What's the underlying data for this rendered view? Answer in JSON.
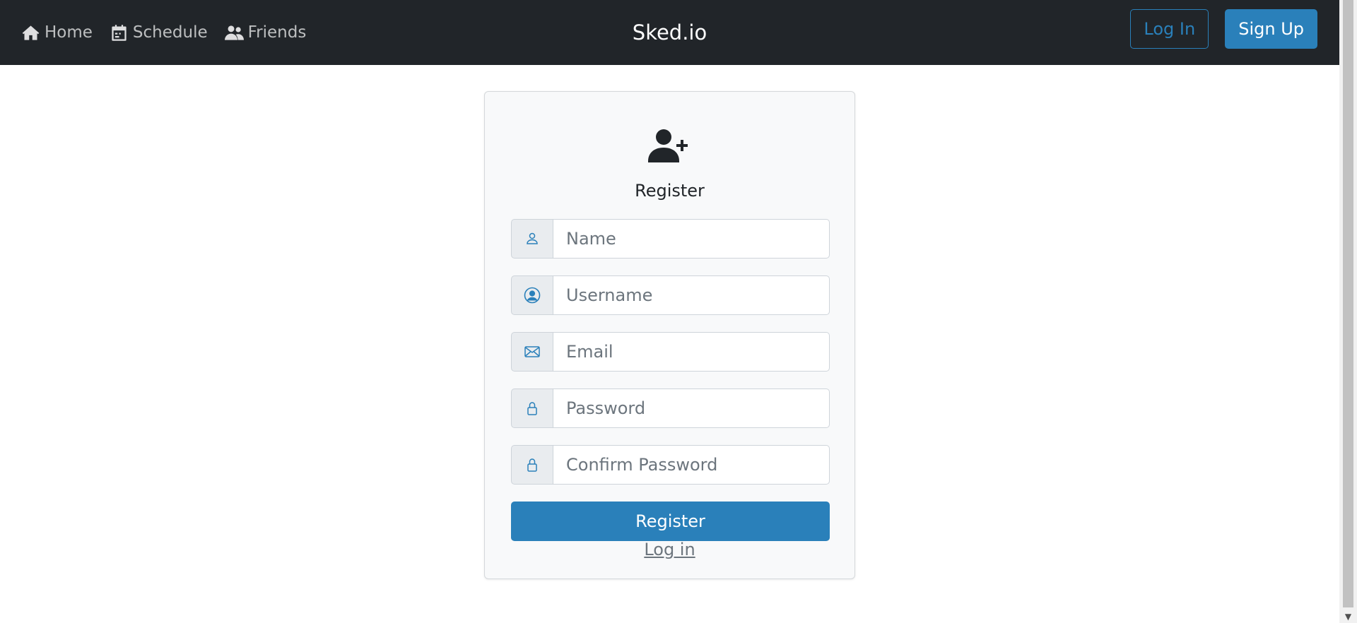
{
  "nav": {
    "links": [
      {
        "label": "Home",
        "icon": "home-icon"
      },
      {
        "label": "Schedule",
        "icon": "calendar-icon"
      },
      {
        "label": "Friends",
        "icon": "users-icon"
      }
    ],
    "brand": "Sked.io",
    "login_label": "Log In",
    "signup_label": "Sign Up"
  },
  "form": {
    "icon": "user-plus-icon",
    "title": "Register",
    "fields": [
      {
        "placeholder": "Name",
        "icon": "person-icon"
      },
      {
        "placeholder": "Username",
        "icon": "person-circle-icon"
      },
      {
        "placeholder": "Email",
        "icon": "envelope-icon"
      },
      {
        "placeholder": "Password",
        "icon": "lock-icon"
      },
      {
        "placeholder": "Confirm Password",
        "icon": "lock-icon"
      }
    ],
    "submit_label": "Register",
    "login_link": "Log in"
  },
  "colors": {
    "navbar_bg": "#212529",
    "primary": "#2a80ba",
    "card_bg": "#f8f9fa"
  }
}
